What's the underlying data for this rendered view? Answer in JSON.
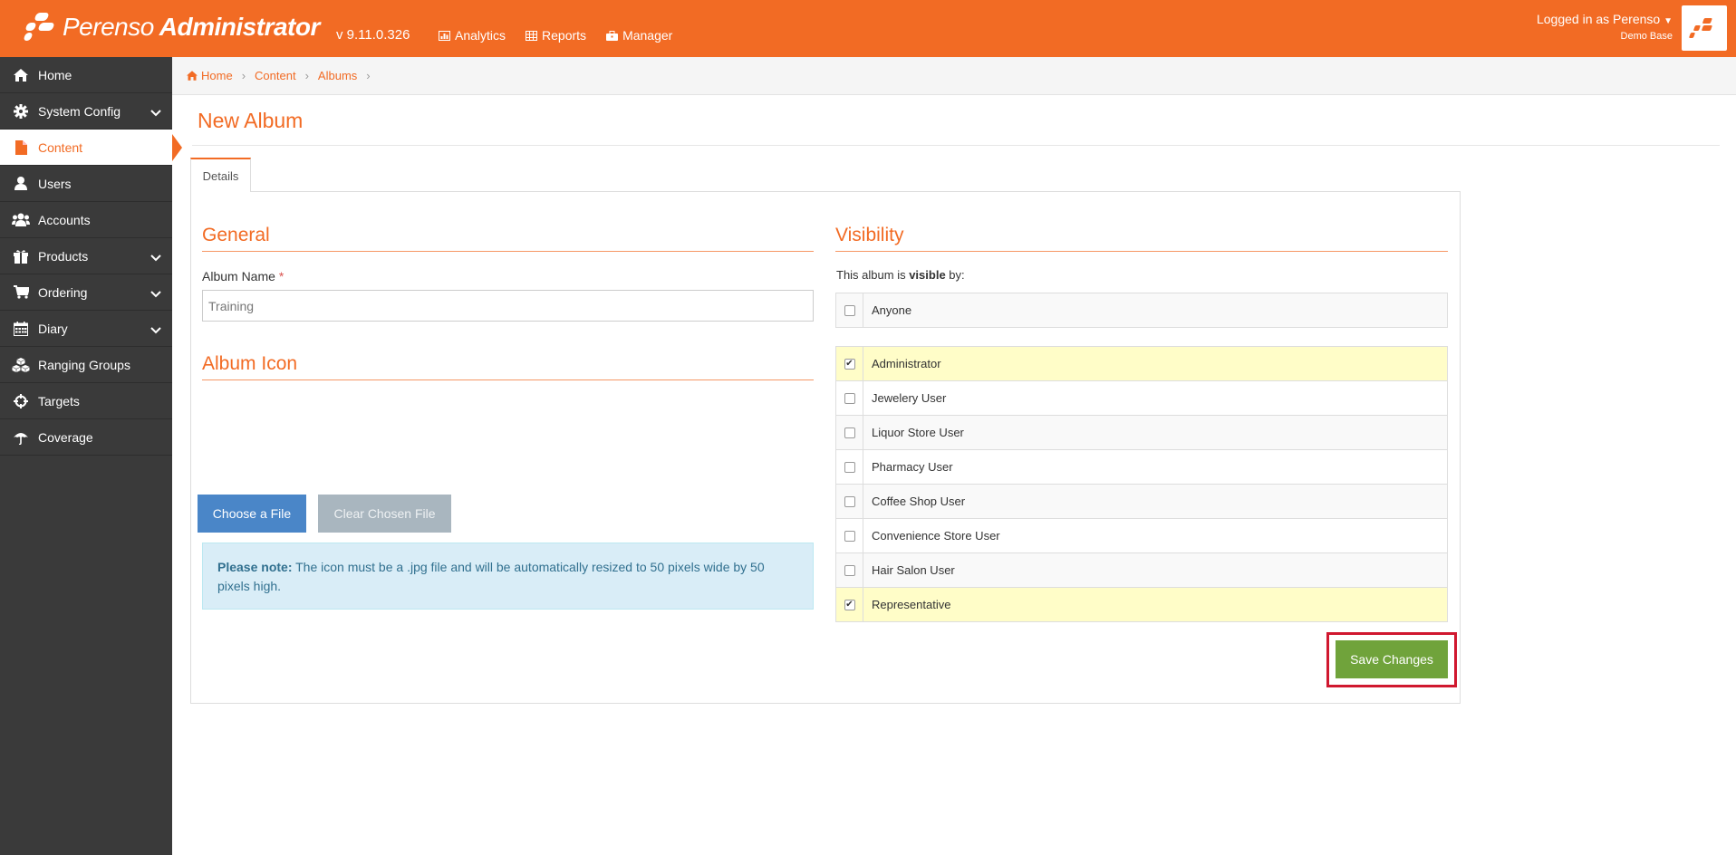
{
  "header": {
    "brand_name": "Perenso",
    "brand_suffix": "Administrator",
    "version": "v 9.11.0.326",
    "nav": [
      {
        "label": "Analytics",
        "icon": "chart-icon"
      },
      {
        "label": "Reports",
        "icon": "table-icon"
      },
      {
        "label": "Manager",
        "icon": "briefcase-icon"
      }
    ],
    "user_login": "Logged in as Perenso",
    "user_base": "Demo Base"
  },
  "sidebar": {
    "items": [
      {
        "label": "Home",
        "icon": "home-icon",
        "has_children": false,
        "active": false
      },
      {
        "label": "System Config",
        "icon": "gear-icon",
        "has_children": true,
        "active": false
      },
      {
        "label": "Content",
        "icon": "file-icon",
        "has_children": false,
        "active": true
      },
      {
        "label": "Users",
        "icon": "user-icon",
        "has_children": false,
        "active": false
      },
      {
        "label": "Accounts",
        "icon": "users-icon",
        "has_children": false,
        "active": false
      },
      {
        "label": "Products",
        "icon": "gift-icon",
        "has_children": true,
        "active": false
      },
      {
        "label": "Ordering",
        "icon": "cart-icon",
        "has_children": true,
        "active": false
      },
      {
        "label": "Diary",
        "icon": "calendar-icon",
        "has_children": true,
        "active": false
      },
      {
        "label": "Ranging Groups",
        "icon": "cubes-icon",
        "has_children": false,
        "active": false
      },
      {
        "label": "Targets",
        "icon": "crosshairs-icon",
        "has_children": false,
        "active": false
      },
      {
        "label": "Coverage",
        "icon": "umbrella-icon",
        "has_children": false,
        "active": false
      }
    ]
  },
  "breadcrumb": [
    "Home",
    "Content",
    "Albums"
  ],
  "page": {
    "title": "New Album",
    "tab": "Details"
  },
  "general": {
    "title": "General",
    "album_name_label": "Album Name",
    "required_mark": "*",
    "album_name_value": "Training"
  },
  "album_icon": {
    "title": "Album Icon",
    "choose_button": "Choose a File",
    "clear_button": "Clear Chosen File",
    "note_bold": "Please note:",
    "note_text": " The icon must be a .jpg file and will be automatically resized to 50 pixels wide by 50 pixels high."
  },
  "visibility": {
    "title": "Visibility",
    "intro_prefix": "This album is ",
    "intro_bold": "visible",
    "intro_suffix": " by:",
    "anyone": {
      "label": "Anyone",
      "checked": false
    },
    "roles": [
      {
        "label": "Administrator",
        "checked": true
      },
      {
        "label": "Jewelery User",
        "checked": false
      },
      {
        "label": "Liquor Store User",
        "checked": false
      },
      {
        "label": "Pharmacy User",
        "checked": false
      },
      {
        "label": "Coffee Shop User",
        "checked": false
      },
      {
        "label": "Convenience Store User",
        "checked": false
      },
      {
        "label": "Hair Salon User",
        "checked": false
      },
      {
        "label": "Representative",
        "checked": true
      }
    ]
  },
  "actions": {
    "save_label": "Save Changes"
  },
  "colors": {
    "accent": "#f26b24",
    "sidebar": "#3a3a3a",
    "primary_button": "#4a86c8",
    "success_button": "#70a33b",
    "highlight_row": "#fffdc8",
    "callout_border": "#d0182f"
  }
}
